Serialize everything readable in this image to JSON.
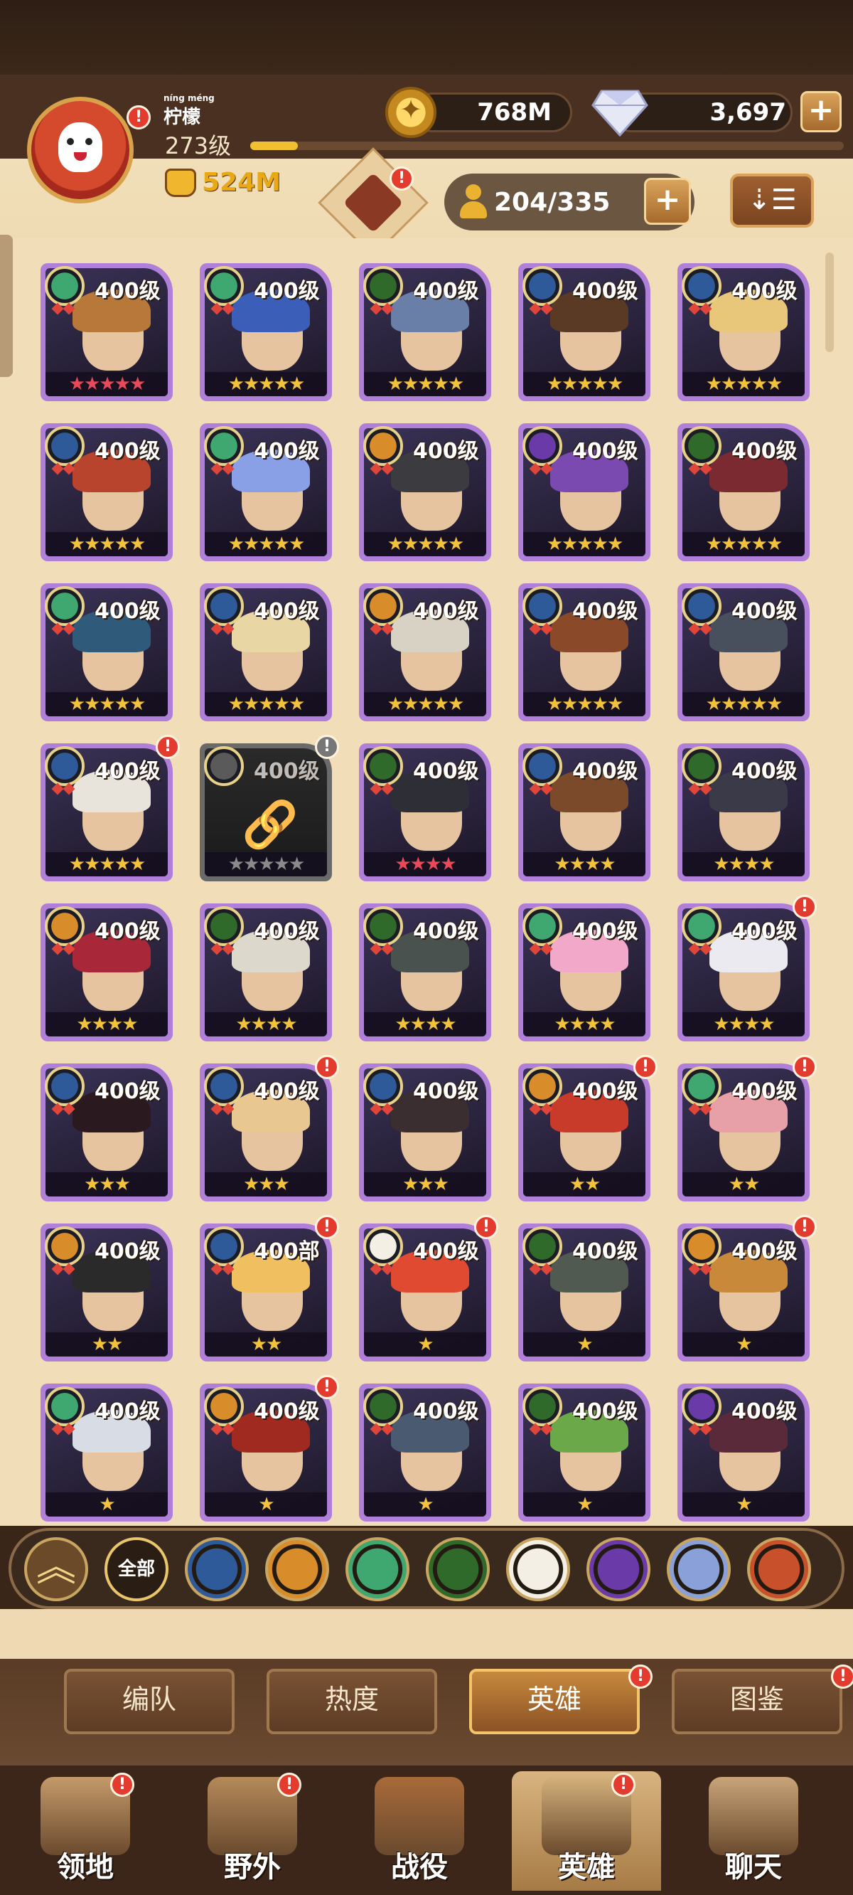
{
  "player": {
    "name": "柠檬",
    "name_ruby": "níng méng",
    "level": "273级",
    "xp_progress": 0.08,
    "power": "524M"
  },
  "resources": {
    "gold": "768M",
    "diamonds": "3,697"
  },
  "hero_count": "204/335",
  "heroes": [
    {
      "level": "400级",
      "faction": "lightbearer",
      "stars": 5,
      "star_color": "red",
      "portrait": "#b7783a",
      "alert": false
    },
    {
      "level": "400级",
      "faction": "lightbearer",
      "stars": 5,
      "star_color": "gold",
      "portrait": "#3b5fb8",
      "alert": false
    },
    {
      "level": "400级",
      "faction": "wilder",
      "stars": 5,
      "star_color": "gold",
      "portrait": "#6a7fa8",
      "alert": false
    },
    {
      "level": "400级",
      "faction": "celestial",
      "stars": 5,
      "star_color": "gold",
      "portrait": "#5a3a24",
      "alert": false
    },
    {
      "level": "400级",
      "faction": "celestial",
      "stars": 5,
      "star_color": "gold",
      "portrait": "#e9c77a",
      "alert": false
    },
    {
      "level": "400级",
      "faction": "celestial",
      "stars": 5,
      "star_color": "gold",
      "portrait": "#b8442e",
      "alert": false
    },
    {
      "level": "400级",
      "faction": "lightbearer",
      "stars": 5,
      "star_color": "gold",
      "portrait": "#8aa0e6",
      "alert": false
    },
    {
      "level": "400级",
      "faction": "mauler",
      "stars": 5,
      "star_color": "gold",
      "portrait": "#3c3c40",
      "alert": false
    },
    {
      "level": "400级",
      "faction": "hypogean",
      "stars": 5,
      "star_color": "gold",
      "portrait": "#7a4ab0",
      "alert": false
    },
    {
      "level": "400级",
      "faction": "wilder",
      "stars": 5,
      "star_color": "gold",
      "portrait": "#7a2a30",
      "alert": false
    },
    {
      "level": "400级",
      "faction": "lightbearer",
      "stars": 5,
      "star_color": "gold",
      "portrait": "#2f5a7a",
      "alert": false
    },
    {
      "level": "400级",
      "faction": "celestial",
      "stars": 5,
      "star_color": "gold",
      "portrait": "#e8d6a4",
      "alert": false
    },
    {
      "level": "400级",
      "faction": "mauler",
      "stars": 5,
      "star_color": "gold",
      "portrait": "#d8d2c4",
      "alert": false
    },
    {
      "level": "400级",
      "faction": "celestial",
      "stars": 5,
      "star_color": "gold",
      "portrait": "#8a4a2a",
      "alert": false
    },
    {
      "level": "400级",
      "faction": "celestial",
      "stars": 5,
      "star_color": "gold",
      "portrait": "#48505e",
      "alert": false
    },
    {
      "level": "400级",
      "faction": "celestial",
      "stars": 5,
      "star_color": "gold",
      "portrait": "#e8e4dc",
      "alert": true
    },
    {
      "level": "400级",
      "faction": "locked",
      "stars": 5,
      "star_color": "gray",
      "portrait": "#4a4a4a",
      "alert": true
    },
    {
      "level": "400级",
      "faction": "wilder",
      "stars": 4,
      "star_color": "red",
      "portrait": "#2e2e36",
      "alert": false
    },
    {
      "level": "400级",
      "faction": "celestial",
      "stars": 4,
      "star_color": "gold",
      "portrait": "#7a4a2a",
      "alert": false
    },
    {
      "level": "400级",
      "faction": "wilder",
      "stars": 4,
      "star_color": "gold",
      "portrait": "#3a3a48",
      "alert": false
    },
    {
      "level": "400级",
      "faction": "mauler",
      "stars": 4,
      "star_color": "gold",
      "portrait": "#a8283a",
      "alert": false
    },
    {
      "level": "400级",
      "faction": "wilder",
      "stars": 4,
      "star_color": "gold",
      "portrait": "#dcd8cc",
      "alert": false
    },
    {
      "level": "400级",
      "faction": "wilder",
      "stars": 4,
      "star_color": "gold",
      "portrait": "#4a5250",
      "alert": false
    },
    {
      "level": "400级",
      "faction": "lightbearer",
      "stars": 4,
      "star_color": "gold",
      "portrait": "#f2a8c8",
      "alert": false
    },
    {
      "level": "400级",
      "faction": "lightbearer",
      "stars": 4,
      "star_color": "gold",
      "portrait": "#eaeaf0",
      "alert": true
    },
    {
      "level": "400级",
      "faction": "celestial",
      "stars": 3,
      "star_color": "gold",
      "portrait": "#2a1a20",
      "alert": false
    },
    {
      "level": "400级",
      "faction": "celestial",
      "stars": 3,
      "star_color": "gold",
      "portrait": "#e8c890",
      "alert": true
    },
    {
      "level": "400级",
      "faction": "celestial",
      "stars": 3,
      "star_color": "gold",
      "portrait": "#3a2e30",
      "alert": false
    },
    {
      "level": "400级",
      "faction": "mauler",
      "stars": 2,
      "star_color": "gold",
      "portrait": "#c83a2a",
      "alert": true
    },
    {
      "level": "400级",
      "faction": "lightbearer",
      "stars": 2,
      "star_color": "gold",
      "portrait": "#e8a0a8",
      "alert": true
    },
    {
      "level": "400级",
      "faction": "mauler",
      "stars": 2,
      "star_color": "gold",
      "portrait": "#2a2a2a",
      "alert": false
    },
    {
      "level": "400部",
      "faction": "celestial",
      "stars": 2,
      "star_color": "gold",
      "portrait": "#f0c060",
      "alert": true
    },
    {
      "level": "400级",
      "faction": "dimensional",
      "stars": 1,
      "star_color": "gold",
      "portrait": "#e04a30",
      "alert": true
    },
    {
      "level": "400级",
      "faction": "wilder",
      "stars": 1,
      "star_color": "gold",
      "portrait": "#505a50",
      "alert": false
    },
    {
      "level": "400级",
      "faction": "mauler",
      "stars": 1,
      "star_color": "gold",
      "portrait": "#c88a3a",
      "alert": true
    },
    {
      "level": "400级",
      "faction": "lightbearer",
      "stars": 1,
      "star_color": "gold",
      "portrait": "#d8dce4",
      "alert": false
    },
    {
      "level": "400级",
      "faction": "mauler",
      "stars": 1,
      "star_color": "gold",
      "portrait": "#a02a20",
      "alert": true
    },
    {
      "level": "400级",
      "faction": "wilder",
      "stars": 1,
      "star_color": "gold",
      "portrait": "#4a5a70",
      "alert": false
    },
    {
      "level": "400级",
      "faction": "wilder",
      "stars": 1,
      "star_color": "gold",
      "portrait": "#6aa84a",
      "alert": false
    },
    {
      "level": "400级",
      "faction": "hypogean",
      "stars": 1,
      "star_color": "gold",
      "portrait": "#5a2a3a",
      "alert": false
    }
  ],
  "filters": [
    {
      "name": "collapse",
      "label": "︽"
    },
    {
      "name": "all",
      "label": "全部"
    },
    {
      "name": "lightbearer",
      "color": "#2f5a9a"
    },
    {
      "name": "mauler",
      "color": "#d98c2a"
    },
    {
      "name": "wilder",
      "color": "#3fa870"
    },
    {
      "name": "graveborn",
      "color": "#2f6a2a"
    },
    {
      "name": "celestial",
      "color": "#f4efe4"
    },
    {
      "name": "hypogean",
      "color": "#6a3aa8"
    },
    {
      "name": "dimensional",
      "color": "#8aa0d8"
    },
    {
      "name": "draconis",
      "color": "#c8502a"
    }
  ],
  "sub_tabs": [
    {
      "label": "编队",
      "active": false,
      "alert": false
    },
    {
      "label": "热度",
      "active": false,
      "alert": false
    },
    {
      "label": "英雄",
      "active": true,
      "alert": true
    },
    {
      "label": "图鉴",
      "active": false,
      "alert": true
    }
  ],
  "nav": [
    {
      "label": "领地",
      "alert": true,
      "icon": "castle-icon",
      "color": "#c49a6a"
    },
    {
      "label": "野外",
      "alert": true,
      "icon": "map-scroll-icon",
      "color": "#b48a5a"
    },
    {
      "label": "战役",
      "alert": false,
      "icon": "sword-icon",
      "color": "#a86a3a"
    },
    {
      "label": "英雄",
      "alert": true,
      "icon": "hero-helmet-icon",
      "color": "#d4b07a",
      "active": true
    },
    {
      "label": "聊天",
      "alert": false,
      "icon": "chat-bubble-icon",
      "color": "#c8a478"
    }
  ],
  "colors": {
    "accent": "#e9a916",
    "panel": "#f1deb8",
    "frame": "#b07fd9",
    "alert": "#e33b2e"
  }
}
